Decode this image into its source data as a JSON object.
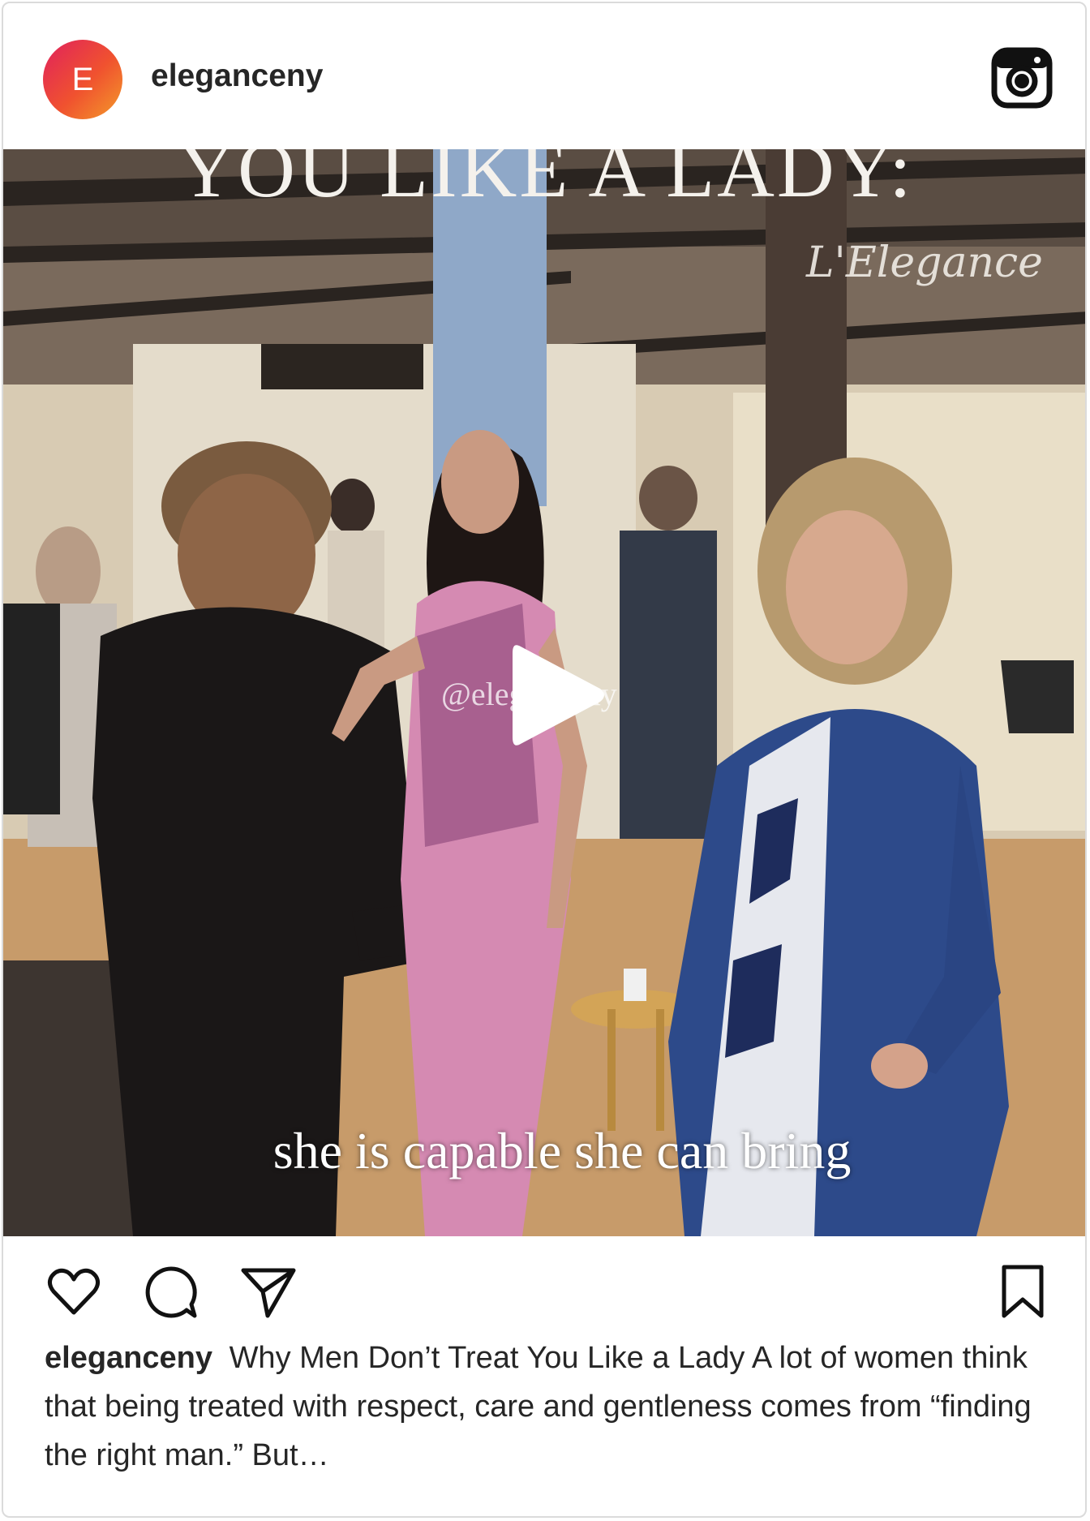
{
  "post": {
    "avatar_letter": "E",
    "username": "eleganceny",
    "media": {
      "overlay_title": "YOU LIKE A LADY:",
      "brand_logo_text": "L'Elegance",
      "watermark": "@eleganceny",
      "caption_overlay": "she is capable she can bring"
    },
    "caption": {
      "username": "eleganceny",
      "text": "Why Men Don’t Treat You Like a Lady A lot of women think that being treated with respect, care and gentleness comes from “finding the right man.” But…"
    },
    "icons": {
      "instagram": "instagram-icon",
      "play": "play-icon",
      "like": "heart-icon",
      "comment": "comment-icon",
      "share": "send-icon",
      "save": "bookmark-icon"
    },
    "colors": {
      "avatar_gradient_start": "#e0215d",
      "avatar_gradient_end": "#f39b2a",
      "text": "#262626",
      "border": "#dbdbdb"
    }
  }
}
